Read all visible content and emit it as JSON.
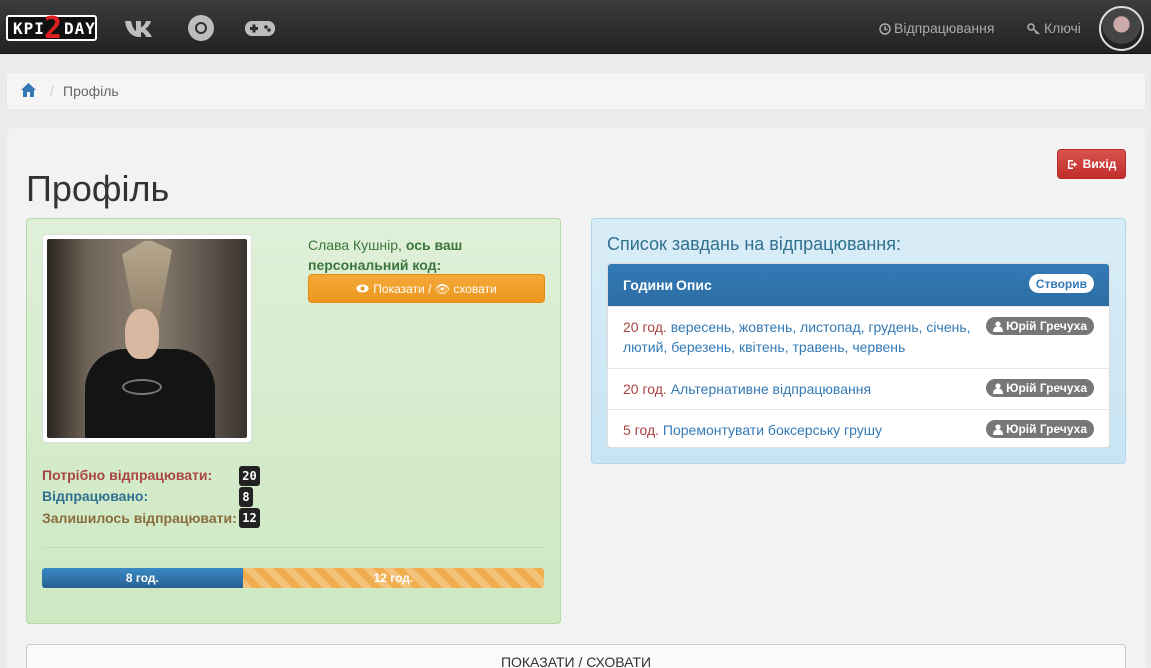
{
  "navbar": {
    "logo": {
      "left": "KPI",
      "middle": "2",
      "right": "DAY"
    },
    "icons": [
      "vk-icon",
      "chrome-icon",
      "gamepad-icon"
    ],
    "links": [
      {
        "label": "Відпрацювання",
        "icon": "clock-icon"
      },
      {
        "label": "Ключі",
        "icon": "key-icon"
      }
    ],
    "avatar_icon": "avatar"
  },
  "breadcrumb": {
    "home_icon": "home-icon",
    "separator": "/",
    "current": "Профіль"
  },
  "page": {
    "title": "Профіль",
    "logout_label": "Вихід"
  },
  "profile": {
    "name": "Слава Кушнір,",
    "greeting_rest": "ось ваш персональний код:",
    "show_code_label": "Показати / 👁 сховати",
    "stats": [
      {
        "label": "Потрібно відпрацювати:",
        "value": "20"
      },
      {
        "label": "Відпрацювано:",
        "value": "8"
      },
      {
        "label": "Залишилось відпрацювати:",
        "value": "12"
      }
    ],
    "progress": {
      "done_label": "8 год.",
      "left_label": "12 год.",
      "done_value": 8,
      "total_value": 20
    }
  },
  "tasks": {
    "title": "Список завдань на відпрацювання:",
    "columns": {
      "hours": "Години",
      "description": "Опис",
      "author": "Створив"
    },
    "rows": [
      {
        "hours": "20 год.",
        "description": "вересень, жовтень, листопад, грудень, січень, лютий, березень, квітень, травень, червень",
        "author": "Юрій Гречуха"
      },
      {
        "hours": "20 год.",
        "description": "Альтернативне відпрацювання",
        "author": "Юрій Гречуха"
      },
      {
        "hours": "5 год.",
        "description": "Поремонтувати боксерську грушу",
        "author": "Юрій Гречуха"
      }
    ]
  },
  "footer": {
    "toggle_label": "ПОКАЗАТИ / СХОВАТИ"
  },
  "colors": {
    "danger": "#a94442",
    "info": "#31708f",
    "warning": "#8a6d3b",
    "primary": "#337ab7",
    "orange": "#f0ad4e",
    "red_button": "#d9534f"
  }
}
